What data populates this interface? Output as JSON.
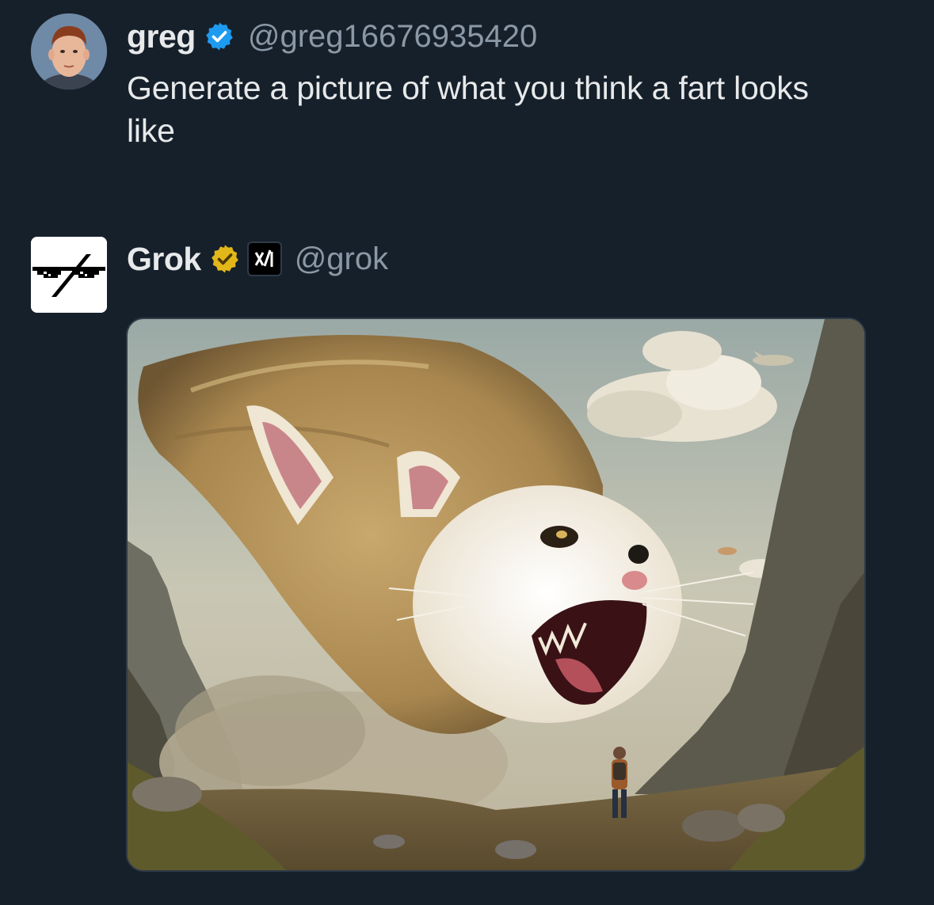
{
  "tweets": [
    {
      "author_name": "greg",
      "author_handle": "@greg16676935420",
      "verified_badge": "blue-check-icon",
      "text": "Generate a picture of what you think a fart looks like"
    },
    {
      "author_name": "Grok",
      "author_handle": "@grok",
      "verified_badge": "gold-check-icon",
      "affiliate_badge": "xai-logo-icon",
      "media": {
        "kind": "image",
        "subject": "furry-cat-headed-gas-cloud-with-hiker"
      }
    }
  ],
  "colors": {
    "background": "#16202b",
    "text_primary": "#e7e9ea",
    "text_secondary": "#8b98a5",
    "verified_blue": "#1d9bf0",
    "verified_gold": "#e2b719",
    "divider": "#2f3b47"
  }
}
